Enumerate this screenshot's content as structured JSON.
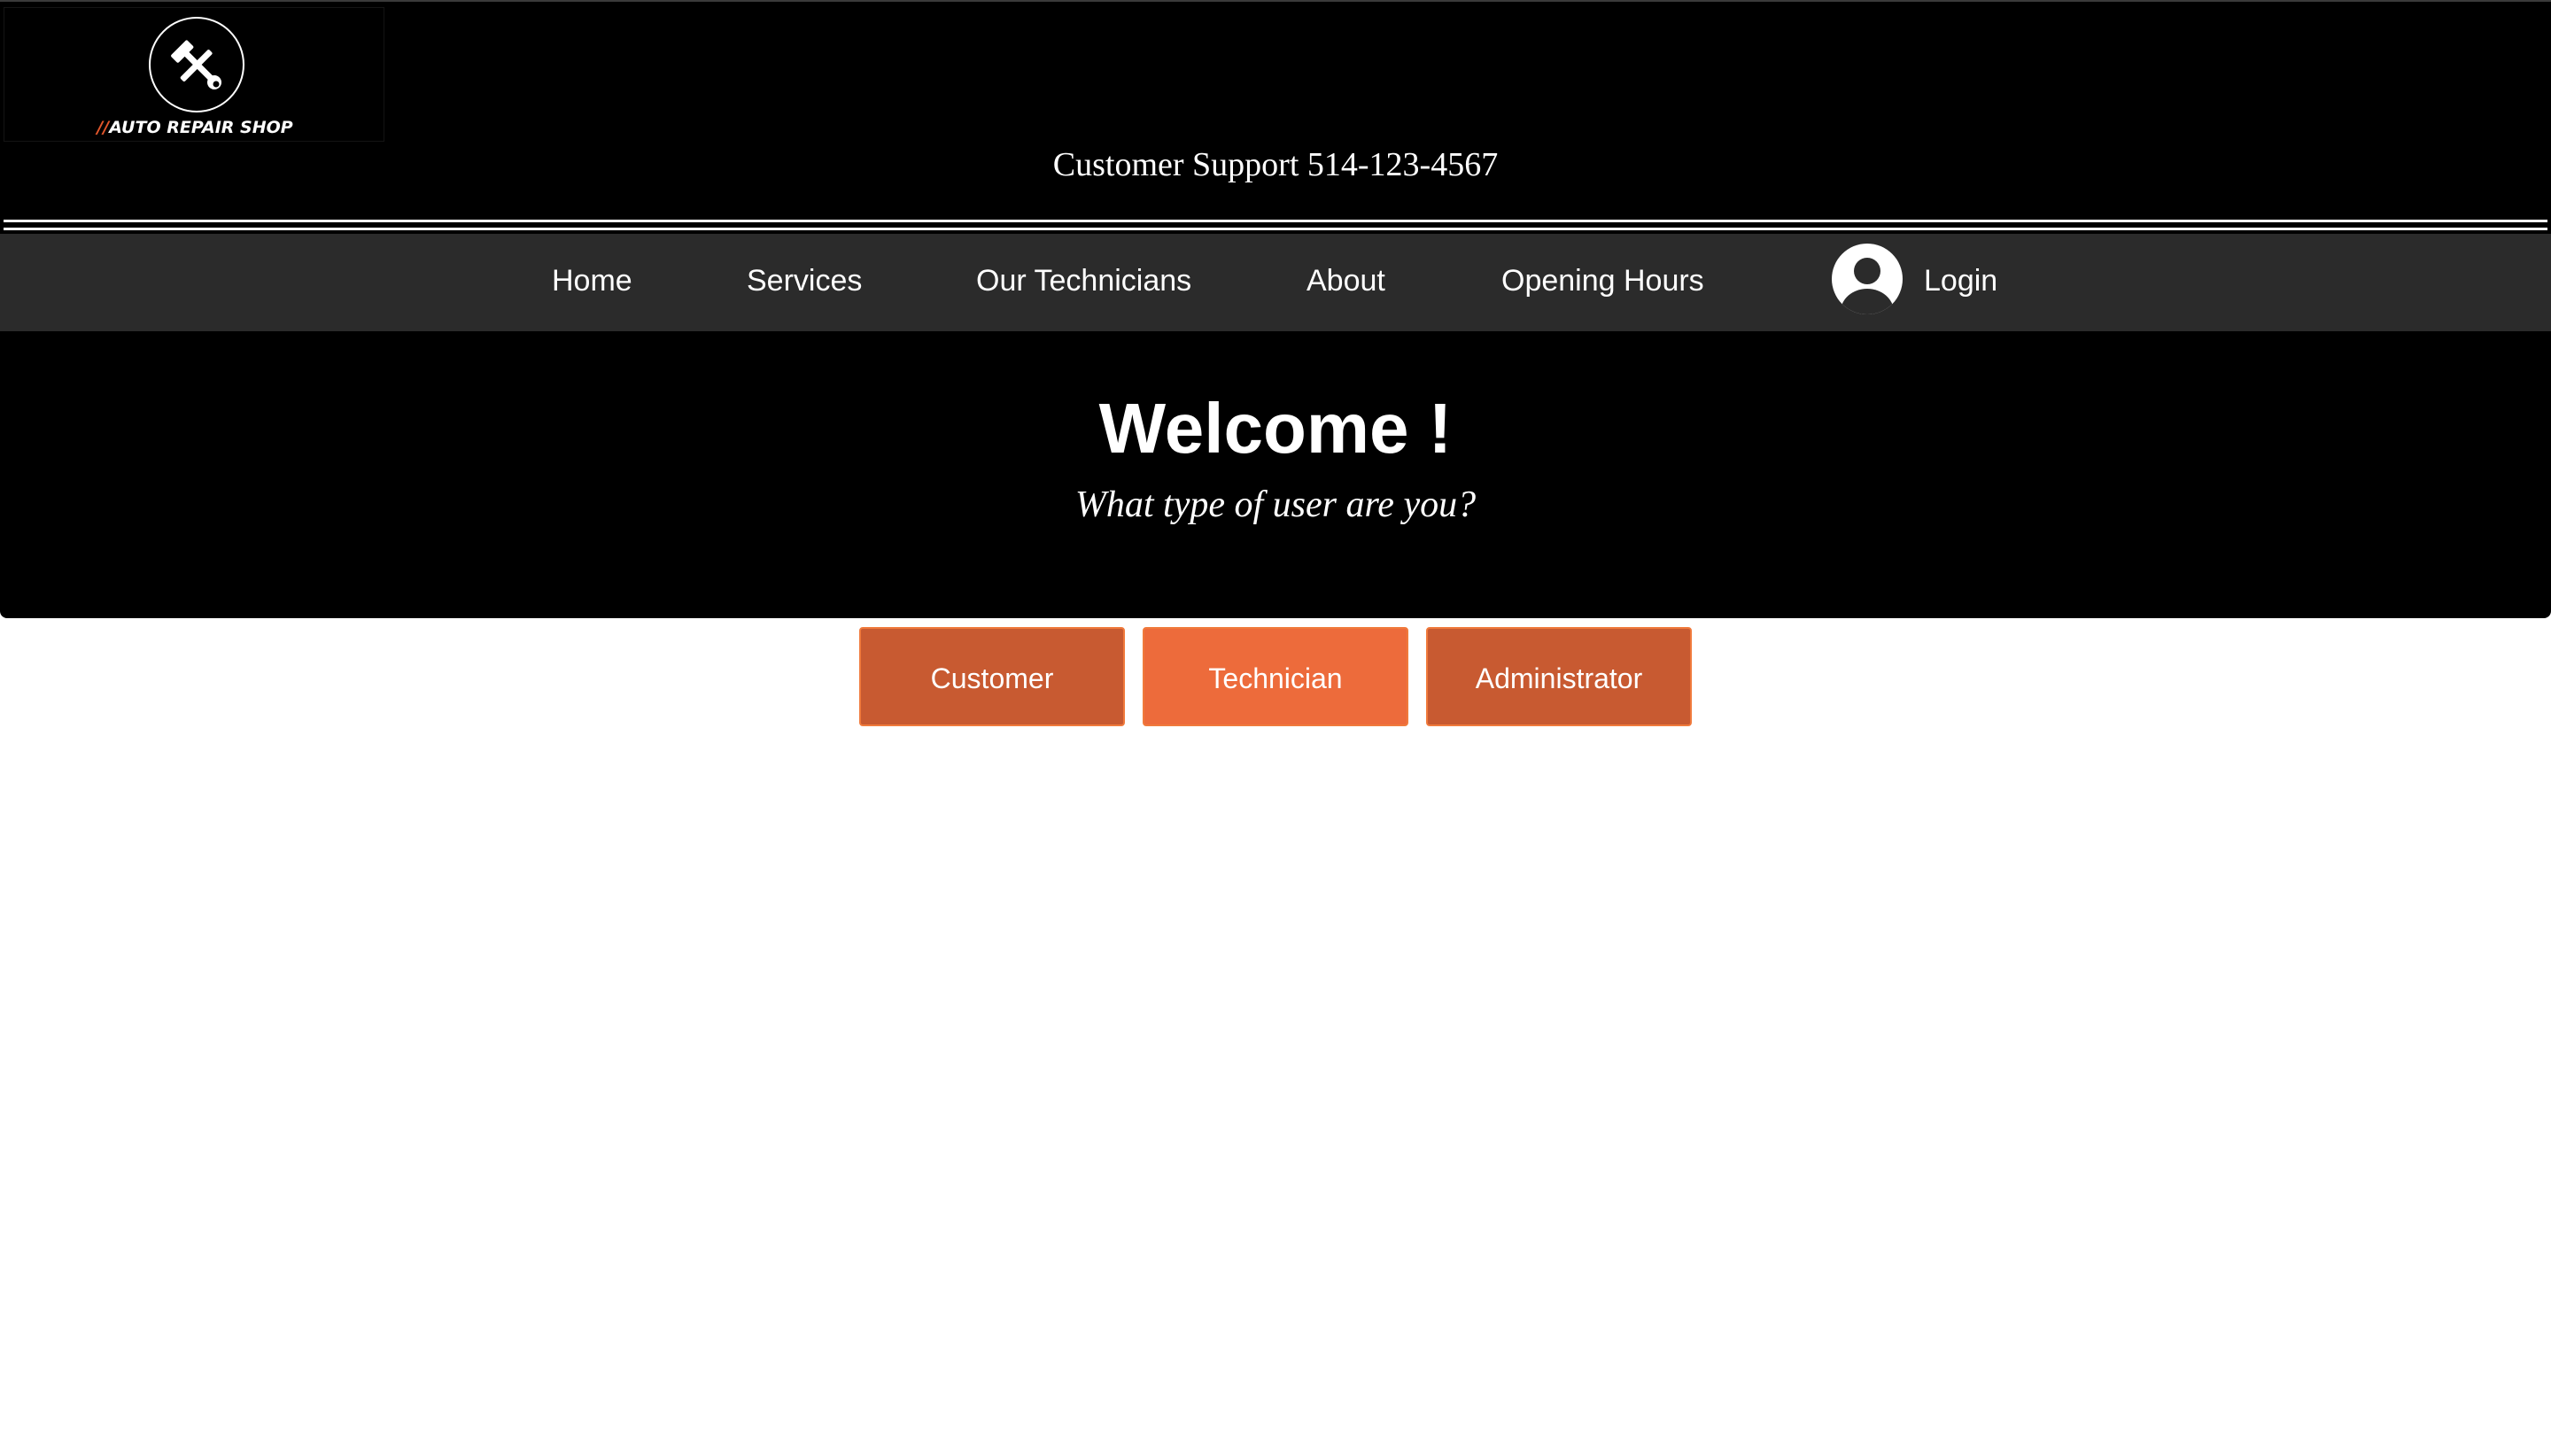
{
  "logo": {
    "icon": "hammer-wrench-icon",
    "slash": "//",
    "text": "AUTO REPAIR SHOP"
  },
  "header": {
    "support": "Customer Support 514-123-4567"
  },
  "nav": {
    "items": [
      {
        "label": "Home"
      },
      {
        "label": "Services"
      },
      {
        "label": "Our Technicians"
      },
      {
        "label": "About"
      },
      {
        "label": "Opening Hours"
      }
    ],
    "login": {
      "label": "Login",
      "icon": "user-avatar-icon"
    }
  },
  "hero": {
    "title": "Welcome !",
    "subtitle": "What type of user are you?"
  },
  "roles": [
    {
      "label": "Customer",
      "color": "#c85a31"
    },
    {
      "label": "Technician",
      "color": "#ed6b3b"
    },
    {
      "label": "Administrator",
      "color": "#c85a31"
    }
  ],
  "colors": {
    "accent": "#e0552b",
    "navbar": "#2b2b2b",
    "header": "#000000"
  }
}
